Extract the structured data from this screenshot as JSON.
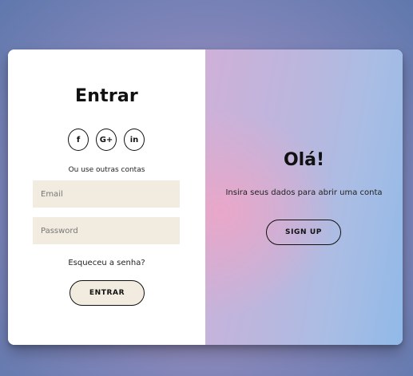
{
  "left_panel": {
    "title": "Entrar",
    "socials": [
      {
        "icon": "facebook-icon",
        "glyph": "f"
      },
      {
        "icon": "google-plus-icon",
        "glyph": "G+"
      },
      {
        "icon": "linkedin-icon",
        "glyph": "in"
      }
    ],
    "subtitle": "Ou use outras contas",
    "email_placeholder": "Email",
    "password_placeholder": "Password",
    "forgot_text": "Esqueceu a senha?",
    "button_label": "ENTRAR"
  },
  "right_panel": {
    "title": "Olá!",
    "text": "Insira seus dados para abrir uma conta",
    "button_label": "SIGN UP"
  },
  "colors": {
    "input_background": "#f2ece0",
    "text": "#111111",
    "gradient_pink": "#e9a7c9",
    "gradient_blue": "#91b9e8"
  }
}
